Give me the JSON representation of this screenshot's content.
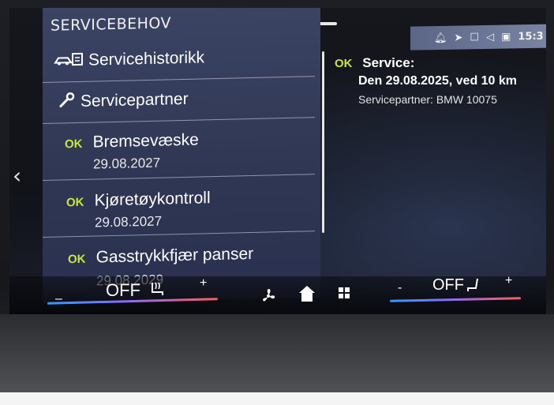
{
  "panel": {
    "title": "SERVICEBEHOV",
    "items": [
      {
        "label": "Servicehistorikk",
        "icon": "car-history-icon"
      },
      {
        "label": "Servicepartner",
        "icon": "wrench-icon"
      },
      {
        "status": "OK",
        "label": "Bremsevæske",
        "date": "29.08.2027"
      },
      {
        "status": "OK",
        "label": "Kjøretøykontroll",
        "date": "29.08.2027"
      },
      {
        "status": "OK",
        "label": "Gasstrykkfjær panser",
        "date": "29.08.2029"
      }
    ]
  },
  "status_bar": {
    "time": "15:3",
    "icons": [
      "bell-icon",
      "navigation-arrow-icon",
      "phone-icon",
      "speaker-icon",
      "profile-icon"
    ]
  },
  "detail": {
    "status": "OK",
    "title": "Service:",
    "line": "Den 29.08.2025, ved 10 km",
    "partner": "Servicepartner: BMW 10075"
  },
  "climate_left": {
    "minus": "–",
    "value": "OFF",
    "plus": "+",
    "icon": "seat-heat-icon"
  },
  "climate_right": {
    "minus": "-",
    "value": "OFF",
    "plus": "+",
    "icon": "seat-icon"
  },
  "colors": {
    "panel_bg": "#36405e",
    "ok_green": "#c8e63c",
    "accent_blue": "#2e9bff",
    "accent_red": "#ff5b5b"
  }
}
